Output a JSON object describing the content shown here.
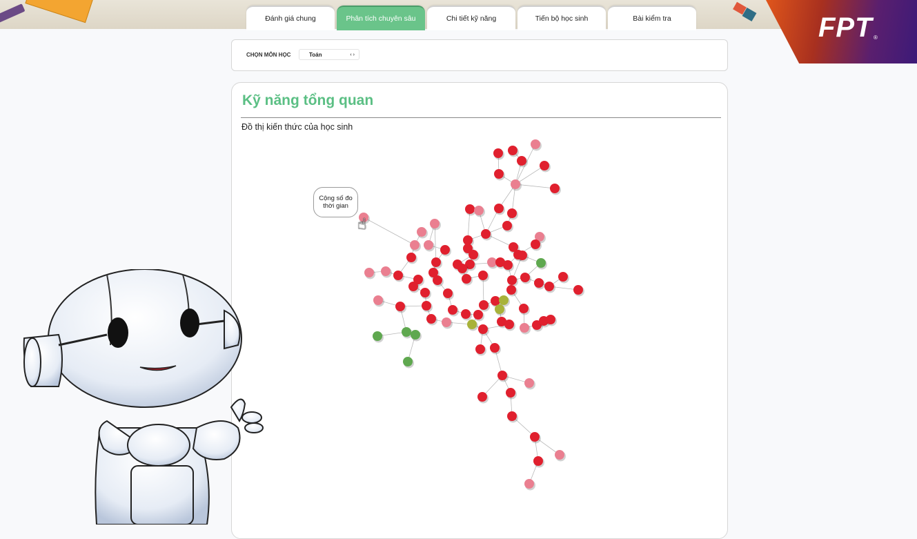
{
  "tabs": [
    {
      "label": "Đánh giá chung",
      "active": false
    },
    {
      "label": "Phân tích chuyên sâu",
      "active": true
    },
    {
      "label": "Chi tiết kỹ năng",
      "active": false
    },
    {
      "label": "Tiến bộ học sinh",
      "active": false
    },
    {
      "label": "Bài kiểm tra",
      "active": false
    }
  ],
  "logo": {
    "text": "FPT",
    "registered": "®"
  },
  "subject_selector": {
    "label": "CHỌN MÔN HỌC",
    "value": "Toán"
  },
  "card": {
    "title": "Kỹ năng tổng quan",
    "subtitle": "Đồ thị kiến thức của học sinh"
  },
  "graph": {
    "tooltip": "Cộng số đo thời gian",
    "node_colors": {
      "weak": "#e0202e",
      "partial": "#ea7f90",
      "mastered": "#5fa84f",
      "developing": "#a8b23a"
    }
  },
  "colors": {
    "accent": "#5bbf84",
    "tab_active": "#6ac48a"
  }
}
